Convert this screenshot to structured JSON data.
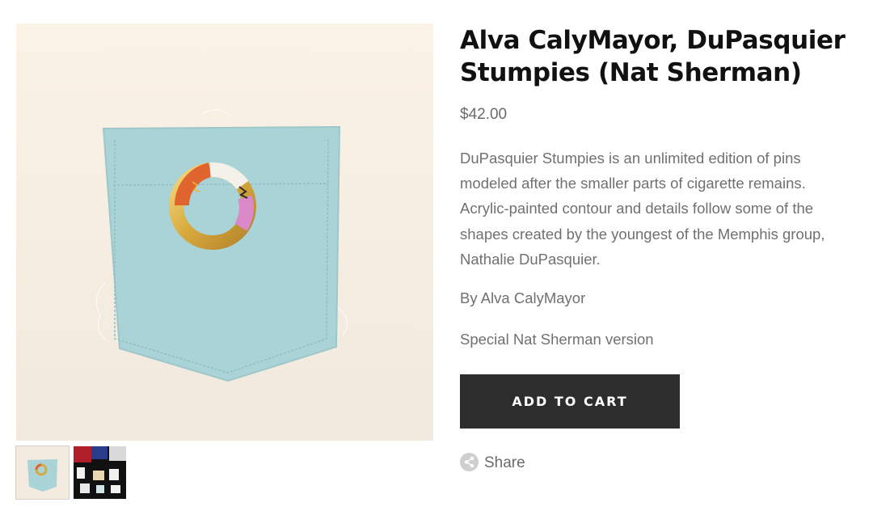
{
  "product": {
    "title": "Alva CalyMayor, DuPasquier Stumpies (Nat Sherman)",
    "price": "$42.00",
    "description": "DuPasquier Stumpies is an unlimited edition of pins modeled after the smaller parts of cigarette remains. Acrylic-painted contour and details follow some of the shapes created by the youngest of the Memphis group, Nathalie DuPasquier.",
    "byline": "By Alva CalyMayor",
    "version": "Special Nat Sherman version"
  },
  "actions": {
    "add_to_cart_label": "ADD TO CART",
    "share_label": "Share"
  },
  "icons": {
    "share": "share-icon"
  },
  "colors": {
    "button_bg": "#2d2d2d",
    "text_muted": "#707070",
    "title": "#111111",
    "pocket": "#a9d3d6"
  }
}
